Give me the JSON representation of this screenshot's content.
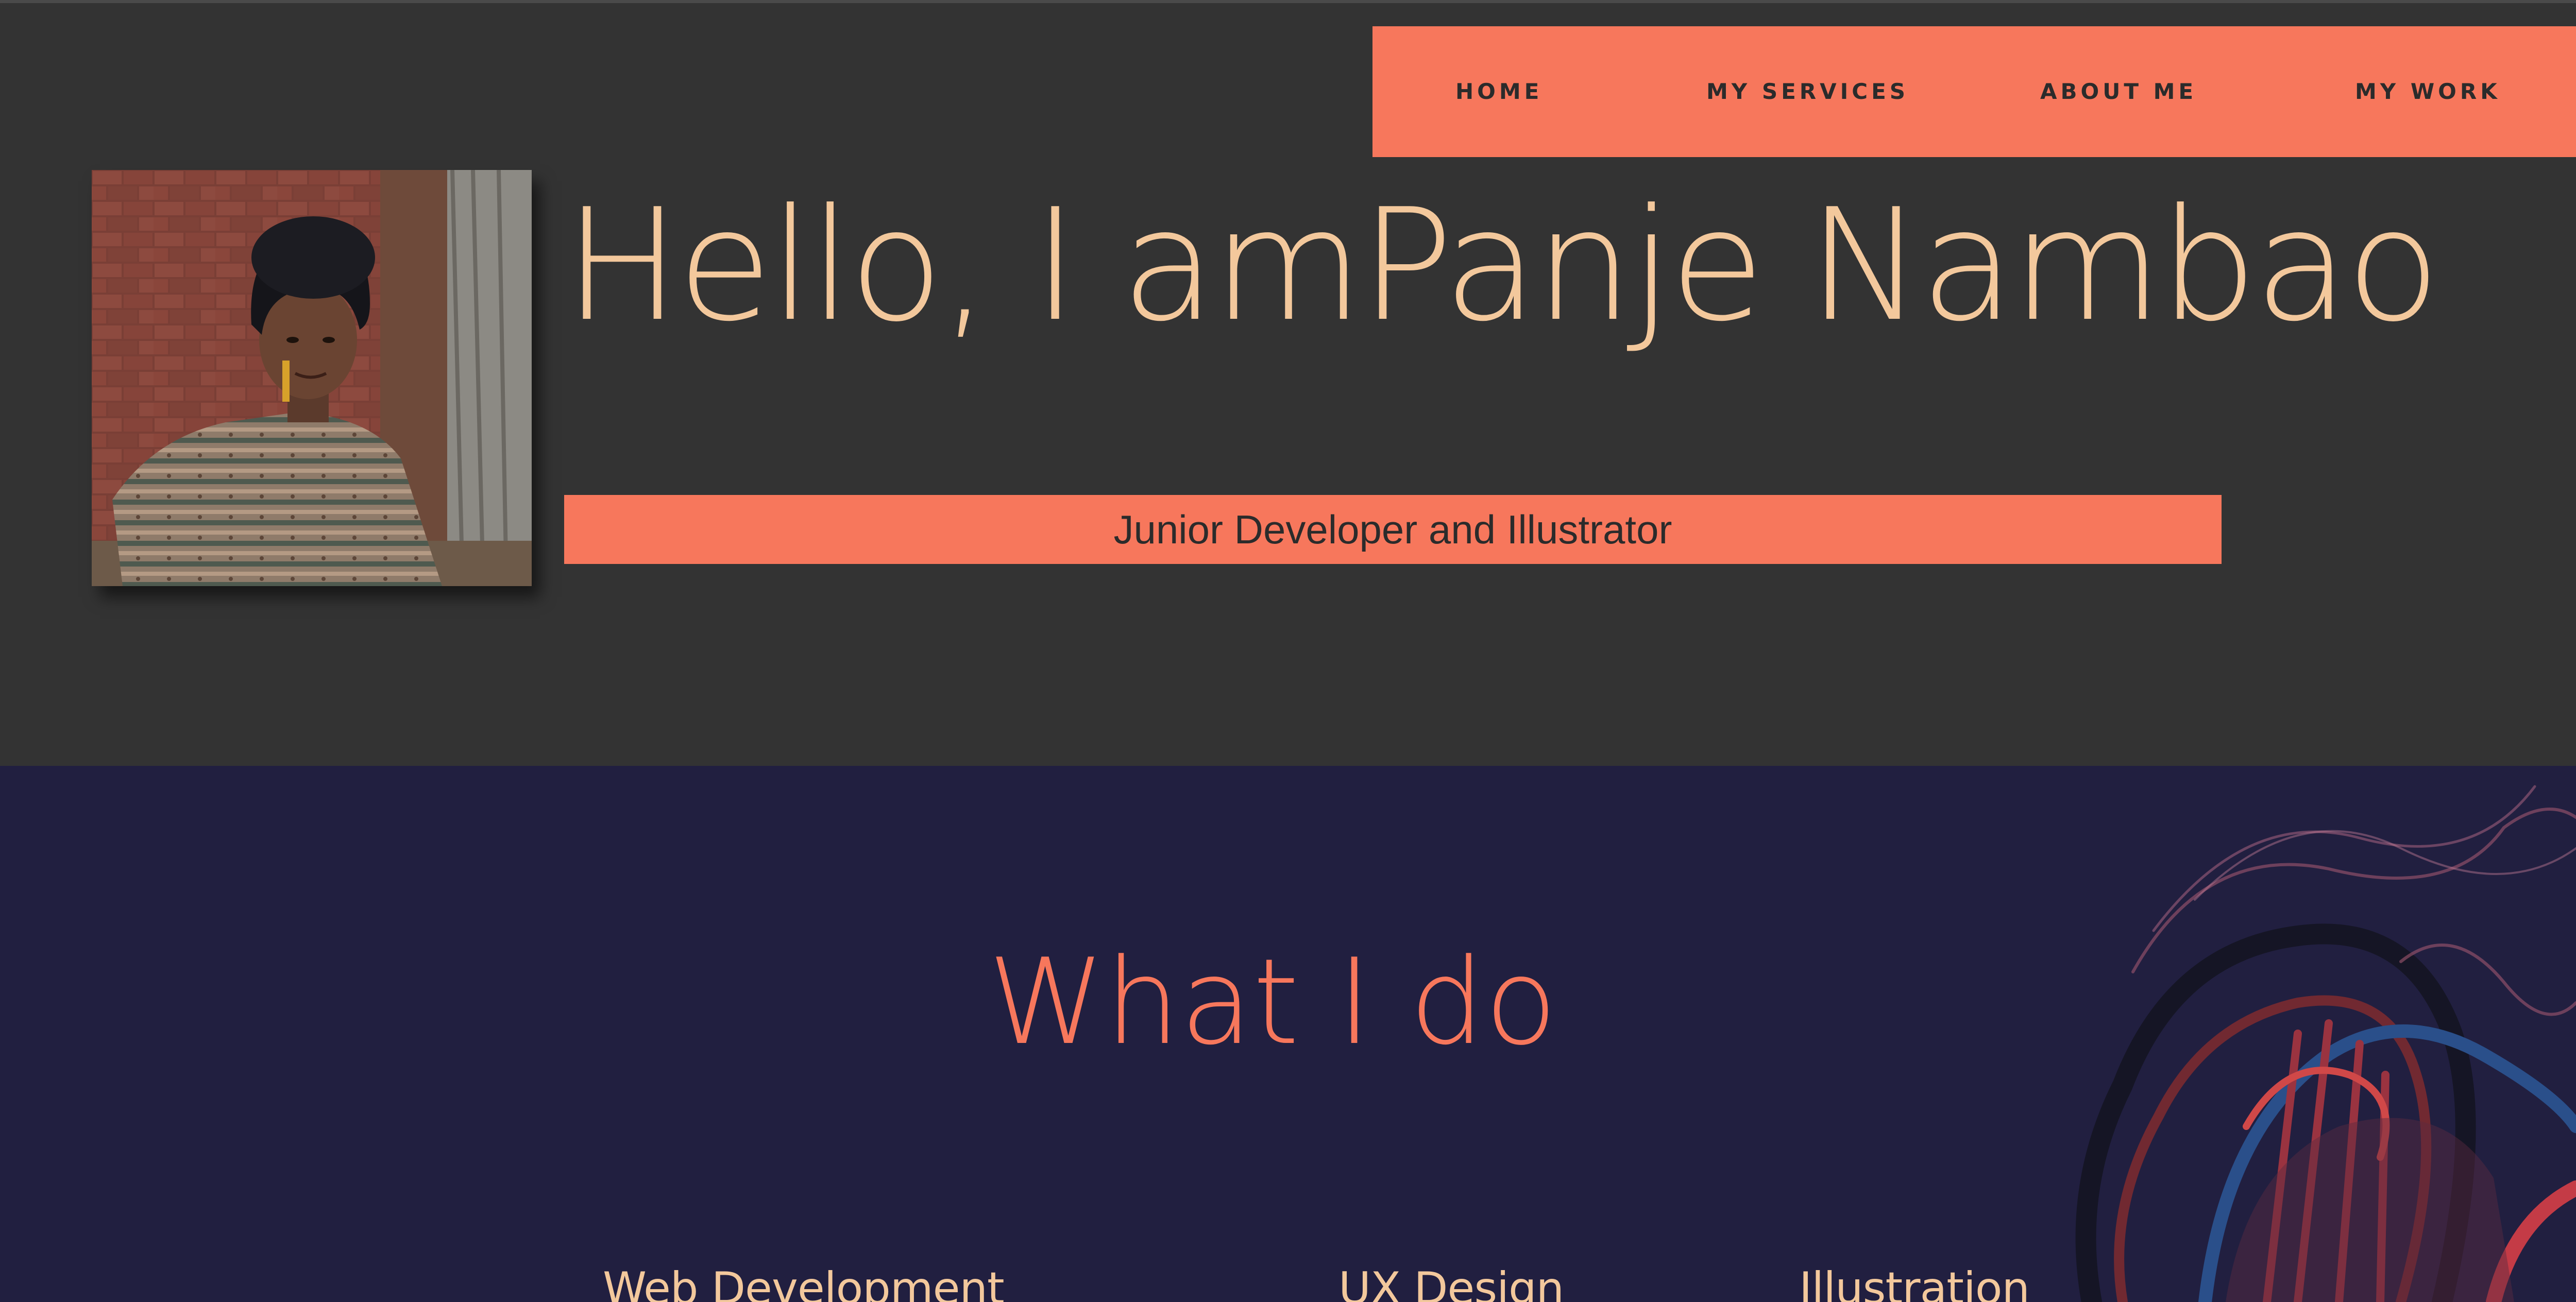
{
  "nav": {
    "items": [
      {
        "label": "HOME"
      },
      {
        "label": "MY SERVICES"
      },
      {
        "label": "ABOUT ME"
      },
      {
        "label": "MY WORK"
      }
    ]
  },
  "hero": {
    "greeting": "Hello, I amPanje Nambao",
    "subtitle": "Junior Developer and Illustrator",
    "photo_icon": "portrait-photo"
  },
  "services": {
    "title": "What I do",
    "items": [
      {
        "label": "Web Development"
      },
      {
        "label": "UX Design"
      },
      {
        "label": "Illustration"
      }
    ]
  },
  "colors": {
    "hero_bg": "#333333",
    "accent": "#f7775c",
    "heading_text": "#f3c89c",
    "services_bg": "#211f40",
    "nav_text": "#2b2b2b"
  }
}
